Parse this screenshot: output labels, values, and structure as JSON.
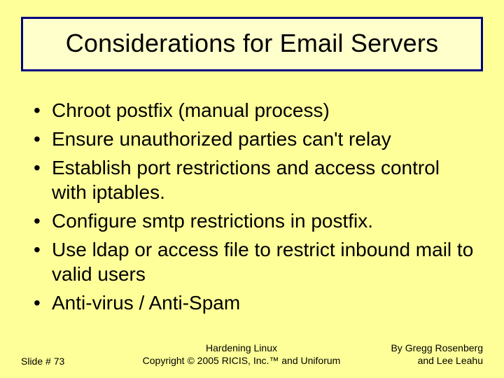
{
  "title": "Considerations for Email Servers",
  "bullets": [
    "Chroot postfix (manual process)",
    "Ensure unauthorized parties can't relay",
    "Establish port restrictions and access control with iptables.",
    "Configure smtp restrictions in postfix.",
    "Use ldap or access file to restrict inbound mail to valid users",
    "Anti-virus / Anti-Spam"
  ],
  "footer": {
    "slide_no": "Slide # 73",
    "center_line1": "Hardening Linux",
    "center_line2": "Copyright © 2005 RICIS, Inc.™ and Uniforum",
    "author_line1": "By Gregg Rosenberg",
    "author_line2": "and Lee Leahu"
  }
}
